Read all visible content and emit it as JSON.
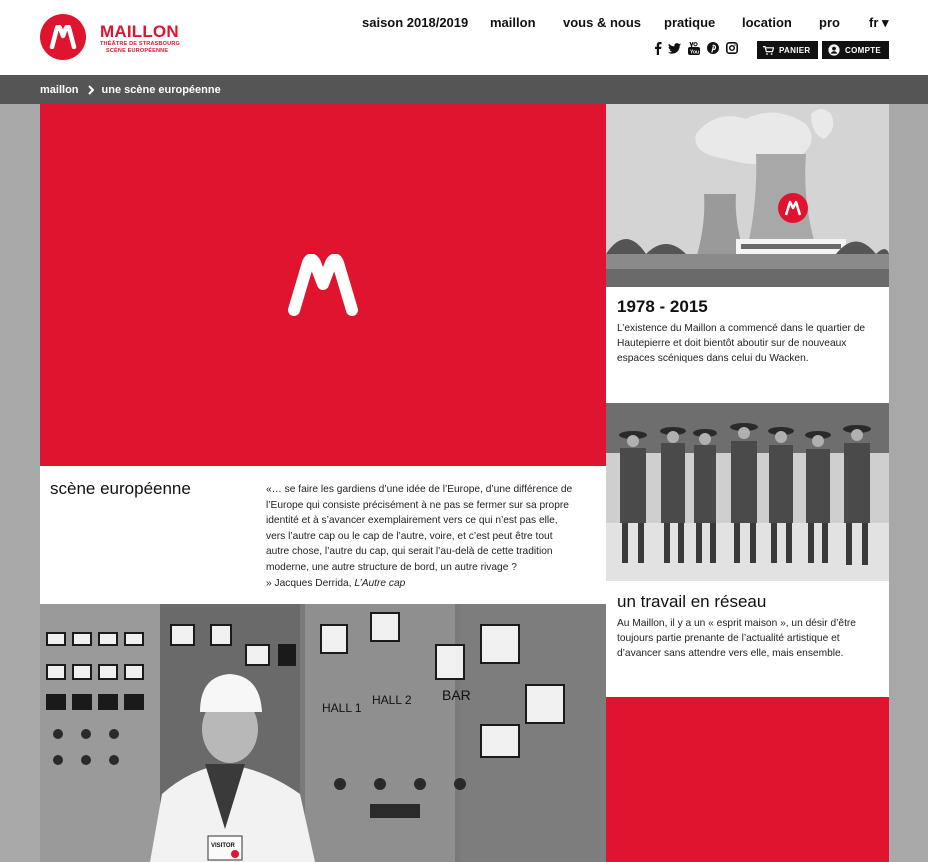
{
  "brand": {
    "name": "MAILLON",
    "sub1": "THÉÂTRE DE STRASBOURG",
    "sub2": "SCÈNE EUROPÉENNE",
    "accent": "#e0142e"
  },
  "nav": {
    "items": [
      {
        "label": "saison 2018/2019"
      },
      {
        "label": "maillon"
      },
      {
        "label": "vous & nous"
      },
      {
        "label": "pratique"
      },
      {
        "label": "location"
      },
      {
        "label": "pro"
      },
      {
        "label": "fr ▾"
      }
    ]
  },
  "social": {
    "icons": [
      "facebook-icon",
      "twitter-icon",
      "youtube-icon",
      "pinterest-icon",
      "instagram-icon"
    ]
  },
  "actions": {
    "cart_label": "PANIER",
    "account_label": "COMPTE"
  },
  "breadcrumb": {
    "root": "maillon",
    "current": "une scène européenne"
  },
  "hero": {
    "title": "scène européenne",
    "quote": "«… se faire les gardiens d’une idée de l’Europe, d’une différence de l’Europe qui consiste précisément à ne pas se fermer sur sa propre identité et à s’avancer exemplairement vers ce qui n’est pas elle, vers l’autre cap ou le cap de l’autre, voire, et c’est peut être tout autre chose, l’autre du cap, qui serait l’au-delà de cette tradition moderne, une autre structure de bord, un autre rivage ?",
    "attribution": "» Jacques Derrida,",
    "book": "L’Autre cap"
  },
  "cards": [
    {
      "title": "1978 - 2015",
      "text": "L’existence du Maillon a commencé dans le quartier de Hautepierre et doit bientôt aboutir sur de nouveaux espaces scéniques dans celui du Wacken."
    },
    {
      "title": "un travail en réseau",
      "text": "Au Maillon, il y a un « esprit maison », un désir d’être toujours partie prenante de l’actualité artistique et d’avancer sans attendre vers elle, mais ensemble."
    }
  ],
  "photo_labels": {
    "hall1": "HALL 1",
    "hall2": "HALL 2",
    "bar": "BAR",
    "visitor": "VISITOR"
  }
}
